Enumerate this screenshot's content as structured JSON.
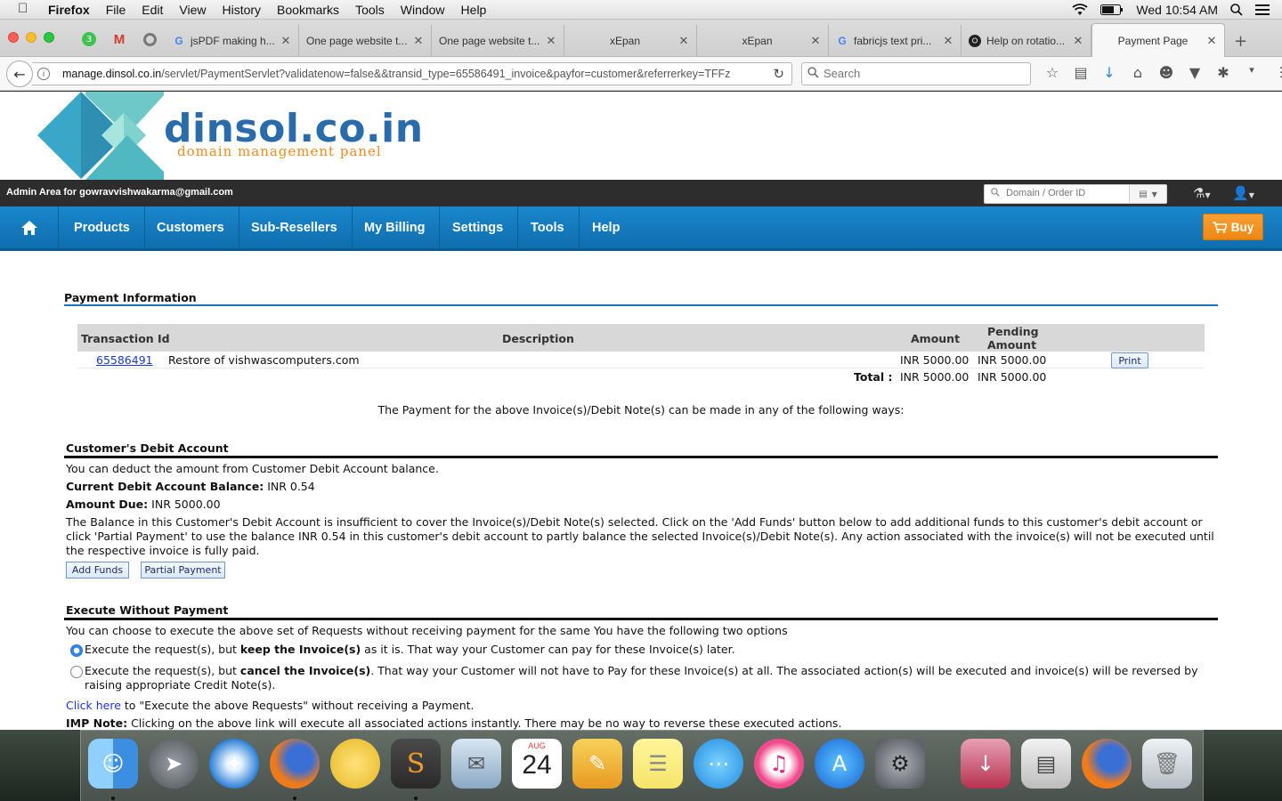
{
  "menubar": {
    "app": "Firefox",
    "menus": [
      "File",
      "Edit",
      "View",
      "History",
      "Bookmarks",
      "Tools",
      "Window",
      "Help"
    ],
    "clock": "Wed 10:54 AM"
  },
  "browser": {
    "tabs": [
      {
        "title": "jsPDF making h...",
        "icon": "google-icon"
      },
      {
        "title": "One page website t...",
        "icon": ""
      },
      {
        "title": "One page website t...",
        "icon": ""
      },
      {
        "title": "xEpan",
        "icon": ""
      },
      {
        "title": "xEpan",
        "icon": ""
      },
      {
        "title": "fabricjs text pri...",
        "icon": "google-icon"
      },
      {
        "title": "Help on rotatio...",
        "icon": "github-icon"
      },
      {
        "title": "Payment Page",
        "icon": ""
      }
    ],
    "url_host": "manage.dinsol.co.in",
    "url_rest": "/servlet/PaymentServlet?validatenow=false&&transid_type=65586491_invoice&payfor=customer&referrerkey=TFFz",
    "search_placeholder": "Search"
  },
  "site": {
    "brand": "dinsol.co.in",
    "tagline": "domain management panel",
    "admin_label": "Admin Area for gowravvishwakarma@gmail.com",
    "domain_search_placeholder": "Domain / Order ID",
    "nav": [
      "Products",
      "Customers",
      "Sub-Resellers",
      "My Billing",
      "Settings",
      "Tools",
      "Help"
    ],
    "buy_label": "Buy",
    "accent": "#1a87cc",
    "buy_color": "#f39a2a"
  },
  "payment": {
    "section_title": "Payment Information",
    "columns": {
      "txid": "Transaction Id",
      "description": "Description",
      "amount": "Amount",
      "pending_line1": "Pending",
      "pending_line2": "Amount"
    },
    "row": {
      "txid": "65586491",
      "description": "Restore of vishwascomputers.com",
      "amount": "INR 5000.00",
      "pending": "INR 5000.00",
      "print_label": "Print"
    },
    "total_label": "Total :",
    "total_amount": "INR 5000.00",
    "total_pending": "INR 5000.00",
    "ways_text": "The Payment for the above Invoice(s)/Debit Note(s) can be made in any of the following ways:"
  },
  "debit": {
    "title": "Customer's Debit Account",
    "intro": "You can deduct the amount from Customer Debit Account balance.",
    "balance_label": "Current Debit Account Balance:",
    "balance_value": "INR 0.54",
    "due_label": "Amount Due:",
    "due_value": "INR 5000.00",
    "note": "The Balance in this Customer's Debit Account is insufficient to cover the Invoice(s)/Debit Note(s) selected. Click on the 'Add Funds' button below to add additional funds to this customer's debit account or click 'Partial Payment' to use the balance INR 0.54 in this customer's debit account to partly balance the selected Invoice(s)/Debit Note(s). Any action associated with the invoice(s) will not be executed until the respective invoice is fully paid.",
    "add_funds_label": "Add Funds",
    "partial_label": "Partial Payment"
  },
  "execute": {
    "title": "Execute Without Payment",
    "intro": "You can choose to execute the above set of Requests without receiving payment for the same You have the following two options",
    "opt1_pre": "Execute the request(s), but ",
    "opt1_bold": "keep the Invoice(s)",
    "opt1_post": " as it is. That way your Customer can pay for these Invoice(s) later.",
    "opt2_pre": "Execute the request(s), but ",
    "opt2_bold": "cancel the Invoice(s)",
    "opt2_post": ". That way your Customer will not have to Pay for these Invoice(s) at all. The associated action(s) will be executed and invoice(s) will be reversed by raising appropriate Credit Note(s).",
    "link_text": "Click here",
    "link_post": " to \"Execute the above Requests\" without receiving a Payment.",
    "imp_label": "IMP Note:",
    "imp_text": " Clicking on the above link will execute all associated actions instantly. There may be no way to reverse these executed actions."
  },
  "dock": {
    "calendar_month": "AUG",
    "calendar_day": "24"
  }
}
